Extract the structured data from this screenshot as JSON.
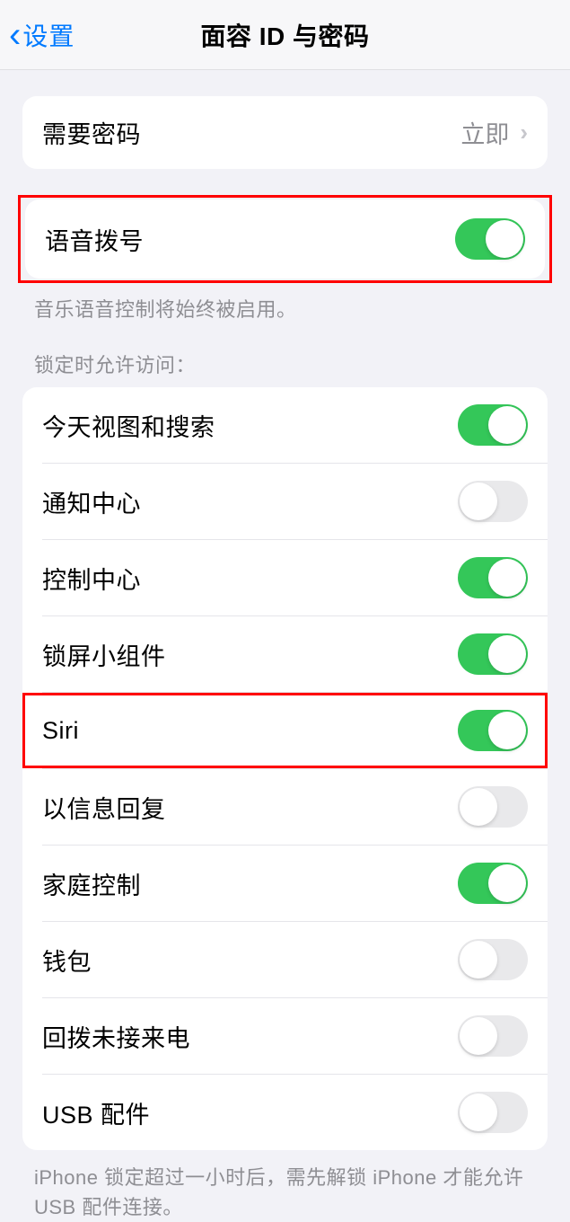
{
  "nav": {
    "back_label": "设置",
    "title": "面容 ID 与密码"
  },
  "require_passcode": {
    "label": "需要密码",
    "value": "立即"
  },
  "voice_dial": {
    "label": "语音拨号",
    "footer": "音乐语音控制将始终被启用。",
    "on": true
  },
  "allow_access_header": "锁定时允许访问：",
  "allow_access": [
    {
      "label": "今天视图和搜索",
      "on": true,
      "name": "today-view-search-toggle"
    },
    {
      "label": "通知中心",
      "on": false,
      "name": "notification-center-toggle"
    },
    {
      "label": "控制中心",
      "on": true,
      "name": "control-center-toggle"
    },
    {
      "label": "锁屏小组件",
      "on": true,
      "name": "lock-screen-widgets-toggle"
    },
    {
      "label": "Siri",
      "on": true,
      "name": "siri-toggle",
      "highlighted": true
    },
    {
      "label": "以信息回复",
      "on": false,
      "name": "reply-with-message-toggle"
    },
    {
      "label": "家庭控制",
      "on": true,
      "name": "home-control-toggle"
    },
    {
      "label": "钱包",
      "on": false,
      "name": "wallet-toggle"
    },
    {
      "label": "回拨未接来电",
      "on": false,
      "name": "return-missed-calls-toggle"
    },
    {
      "label": "USB 配件",
      "on": false,
      "name": "usb-accessories-toggle"
    }
  ],
  "usb_footer": "iPhone 锁定超过一小时后，需先解锁 iPhone 才能允许USB 配件连接。"
}
